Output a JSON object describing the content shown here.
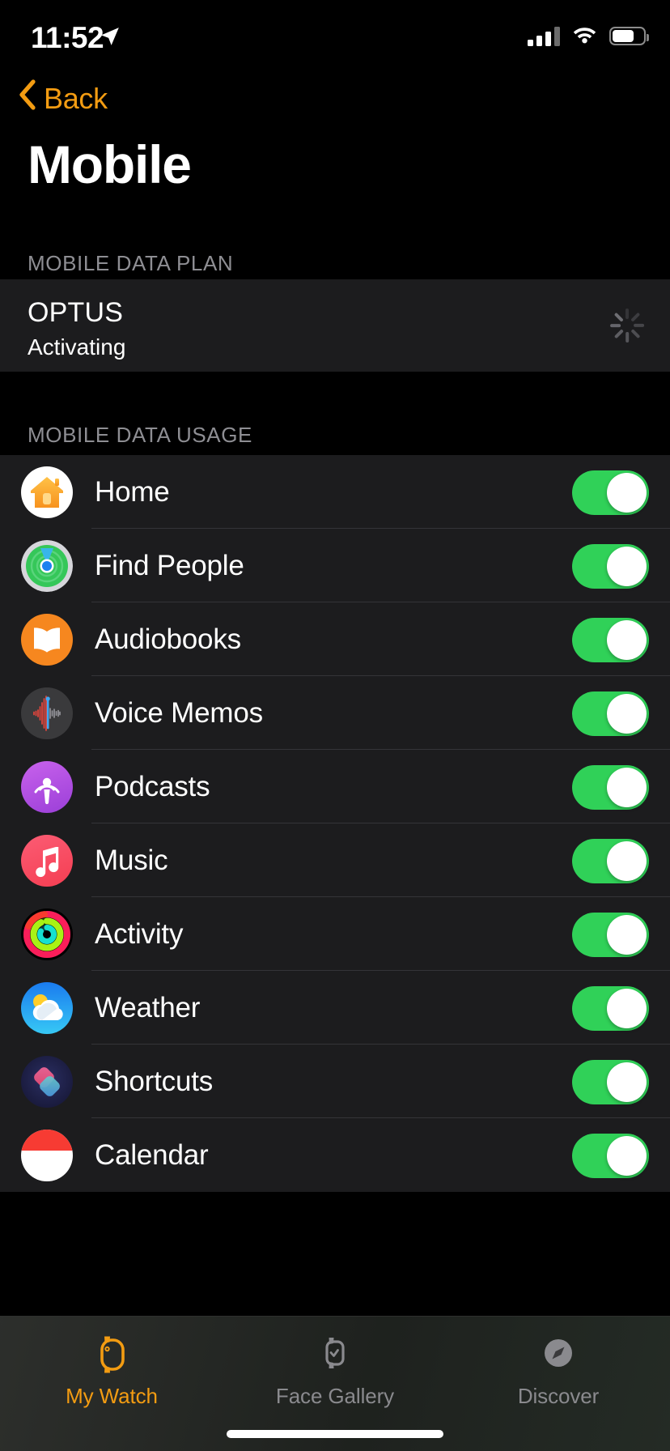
{
  "status_bar": {
    "time": "11:52",
    "location_icon": "location-arrow-icon",
    "signal_icon": "cellular-signal-icon",
    "signal_bars_filled": 3,
    "wifi_icon": "wifi-icon",
    "battery_icon": "battery-icon",
    "battery_level_percent": 62
  },
  "nav": {
    "back_label": "Back",
    "back_icon": "chevron-left-icon",
    "accent_color": "#F39C12"
  },
  "header": {
    "title": "Mobile"
  },
  "sections": [
    {
      "id": "mobile-data-plan",
      "header": "MOBILE DATA PLAN",
      "plan": {
        "carrier": "OPTUS",
        "status": "Activating",
        "spinner_icon": "activity-spinner-icon"
      }
    },
    {
      "id": "mobile-data-usage",
      "header": "MOBILE DATA USAGE"
    }
  ],
  "apps": [
    {
      "name": "Home",
      "icon": "home-app-icon",
      "toggle_on": true
    },
    {
      "name": "Find People",
      "icon": "find-people-app-icon",
      "toggle_on": true
    },
    {
      "name": "Audiobooks",
      "icon": "audiobooks-app-icon",
      "toggle_on": true
    },
    {
      "name": "Voice Memos",
      "icon": "voice-memos-app-icon",
      "toggle_on": true
    },
    {
      "name": "Podcasts",
      "icon": "podcasts-app-icon",
      "toggle_on": true
    },
    {
      "name": "Music",
      "icon": "music-app-icon",
      "toggle_on": true
    },
    {
      "name": "Activity",
      "icon": "activity-app-icon",
      "toggle_on": true
    },
    {
      "name": "Weather",
      "icon": "weather-app-icon",
      "toggle_on": true
    },
    {
      "name": "Shortcuts",
      "icon": "shortcuts-app-icon",
      "toggle_on": true
    },
    {
      "name": "Calendar",
      "icon": "calendar-app-icon",
      "toggle_on": true
    }
  ],
  "tab_bar": {
    "tabs": [
      {
        "label": "My Watch",
        "icon": "watch-icon",
        "selected": true
      },
      {
        "label": "Face Gallery",
        "icon": "watch-face-icon",
        "selected": false
      },
      {
        "label": "Discover",
        "icon": "compass-icon",
        "selected": false
      }
    ],
    "selected_color": "#F39C12",
    "unselected_color": "#8A8A8E"
  },
  "colors": {
    "background": "#000000",
    "row_background": "#1C1C1E",
    "toggle_on": "#30D158",
    "section_header_text": "#8E8E93",
    "separator": "#343438"
  }
}
